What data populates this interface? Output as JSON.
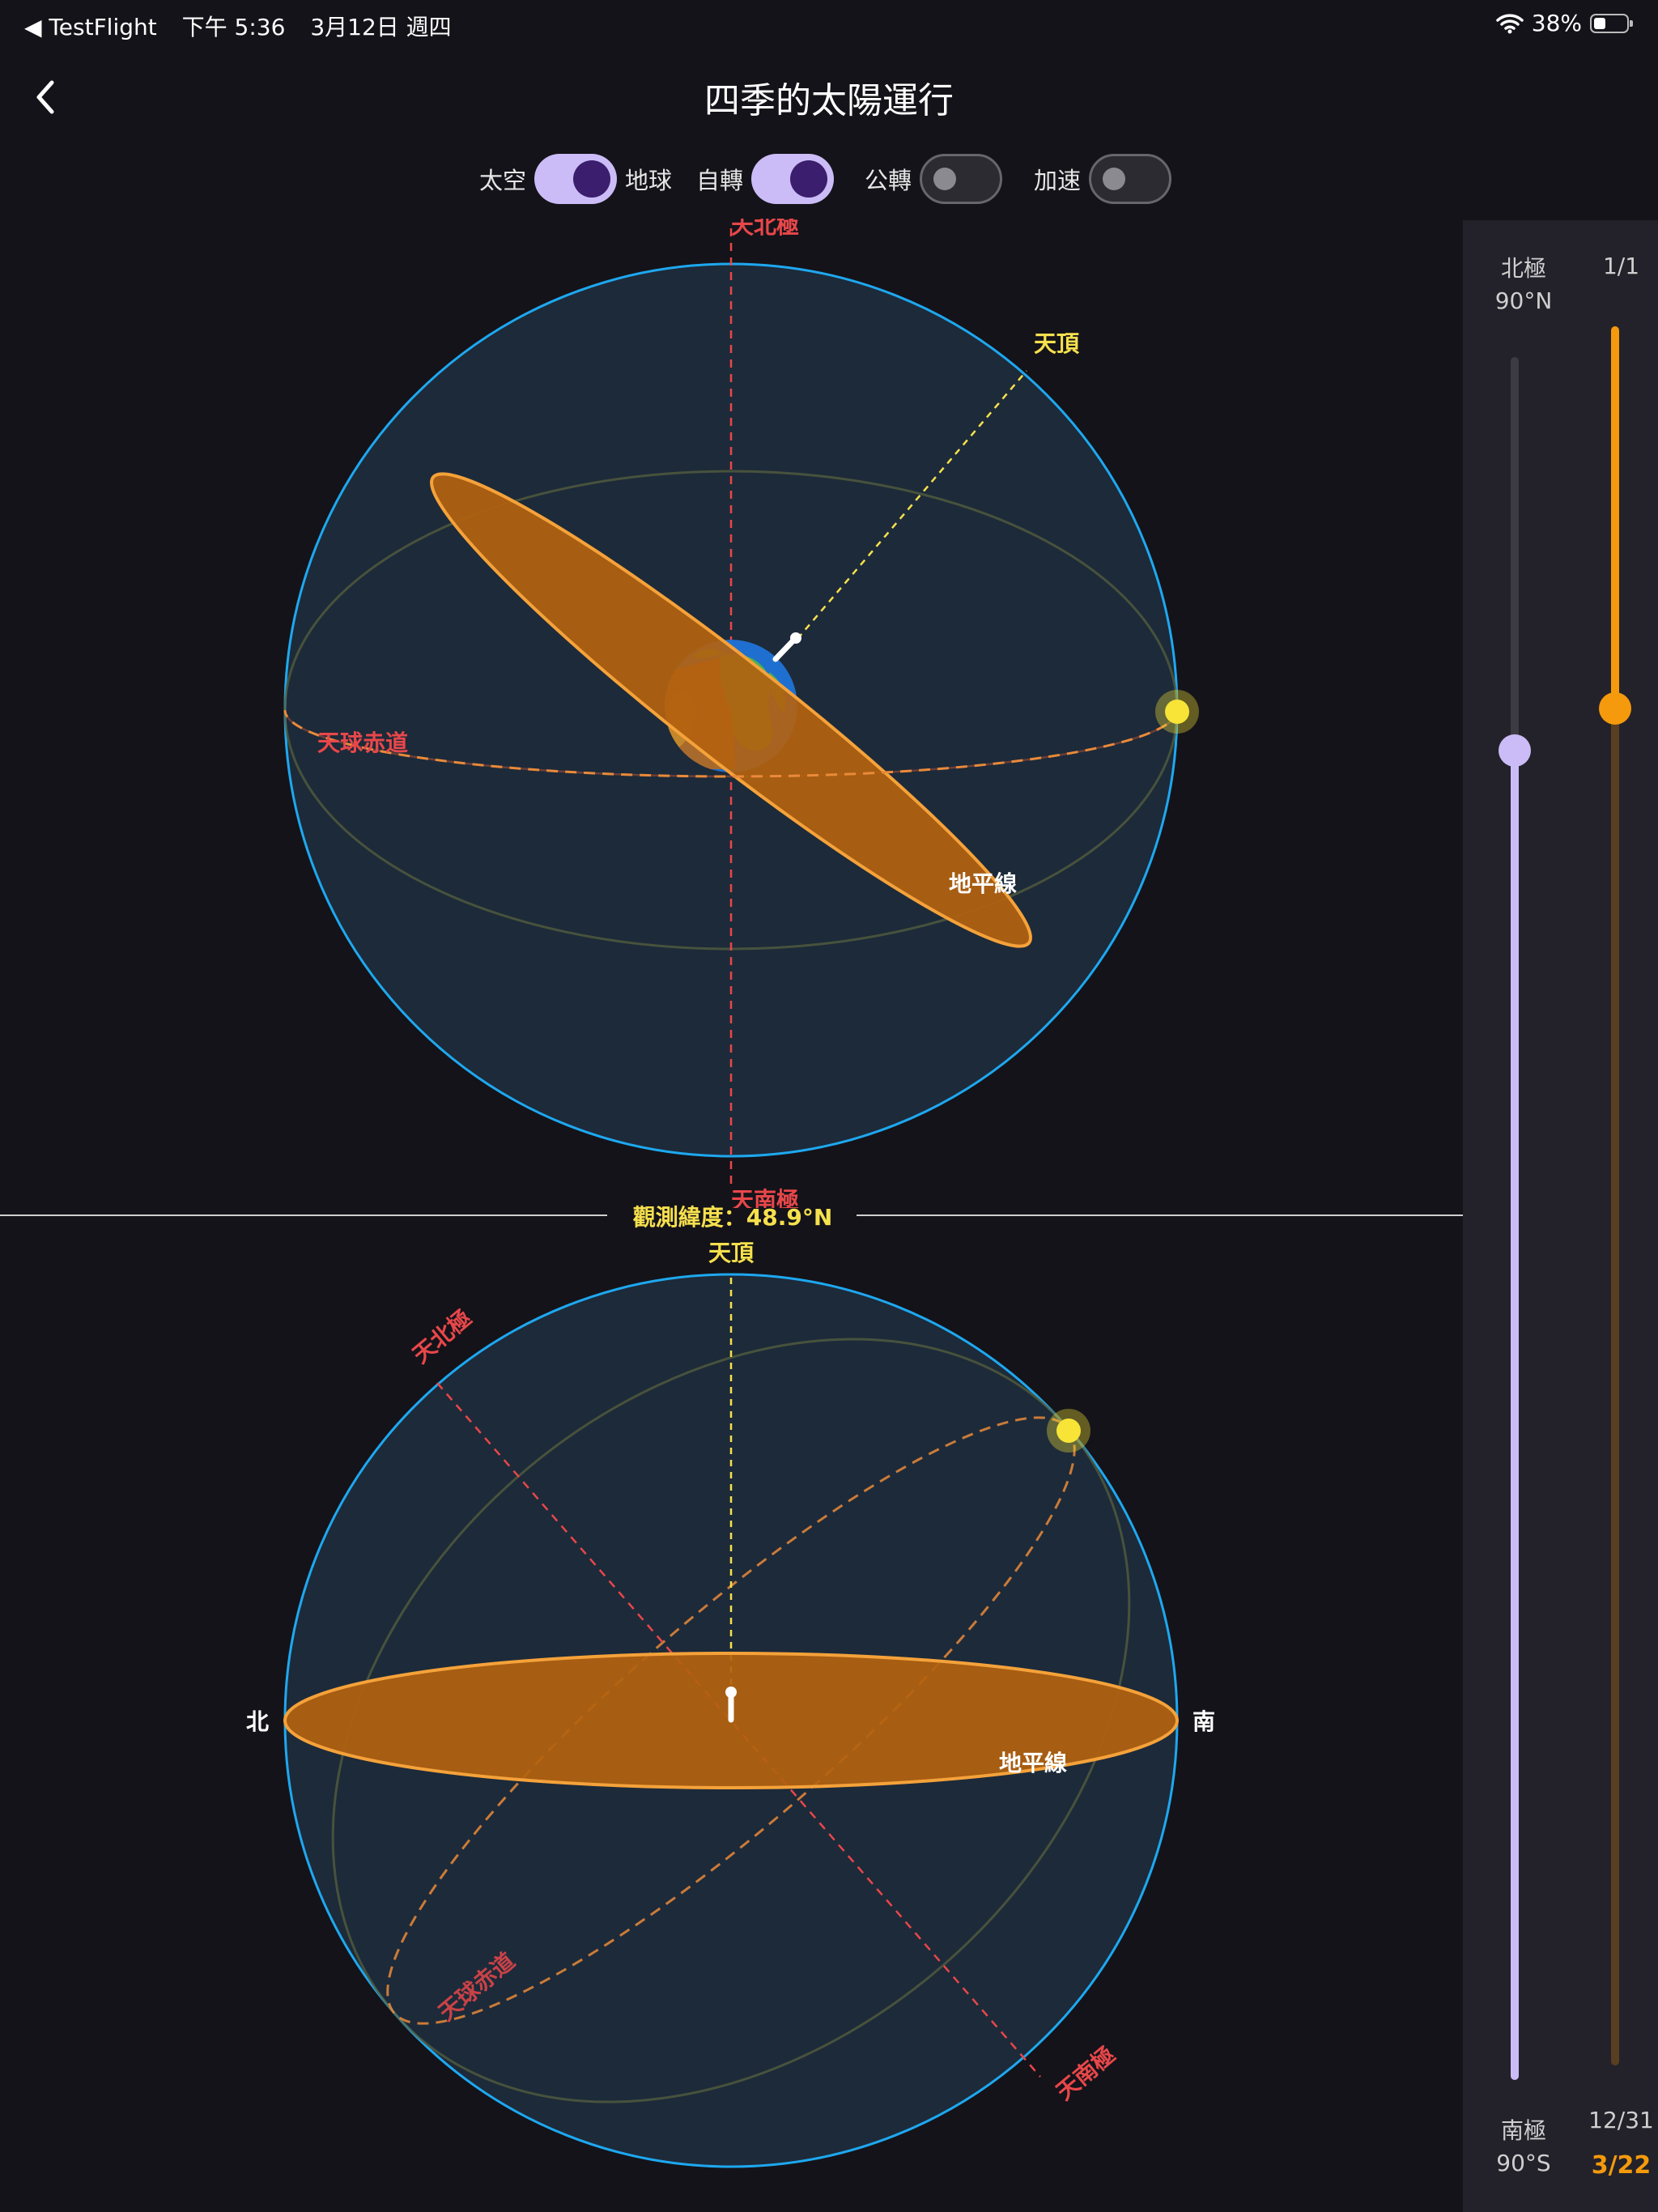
{
  "status_bar": {
    "back_app": "◀ TestFlight",
    "time": "下午 5:36",
    "date": "3月12日 週四",
    "battery": "38%",
    "battery_level": 0.38
  },
  "header": {
    "title": "四季的太陽運行"
  },
  "toggles": [
    {
      "left_label": "太空",
      "right_label": "地球",
      "state": "on"
    },
    {
      "left_label": "自轉",
      "state": "on"
    },
    {
      "left_label": "公轉",
      "state": "off"
    },
    {
      "left_label": "加速",
      "state": "off"
    }
  ],
  "space_view": {
    "top_pole": "天北極",
    "bottom_pole": "天南極",
    "zenith": "天頂",
    "equator": "天球赤道",
    "horizon": "地平線"
  },
  "observation": {
    "label": "觀測緯度：48.9°N"
  },
  "earth_view": {
    "zenith": "天頂",
    "north_pole": "天北極",
    "south_pole": "天南極",
    "equator": "天球赤道",
    "horizon": "地平線",
    "north": "北",
    "south": "南"
  },
  "latitude_slider": {
    "top_label": "北極",
    "top_value": "90°N",
    "bottom_label": "南極",
    "bottom_value": "90°S",
    "value_deg": 48.9
  },
  "date_slider": {
    "start": "1/1",
    "end": "12/31",
    "current": "3/22",
    "day_of_year": 81,
    "days_in_year": 365
  },
  "colors": {
    "background": "#141319",
    "sphere_stroke": "#1ea8f0",
    "sphere_fill": "#1d2a39",
    "horizon_fill": "#b3620f",
    "horizon_stroke": "#f5a23a",
    "pole_red": "#e8474a",
    "zenith_yellow": "#f6e04d",
    "sun": "#f7e436",
    "latitude_accent": "#cbbcf7",
    "date_accent": "#f59a0c"
  }
}
